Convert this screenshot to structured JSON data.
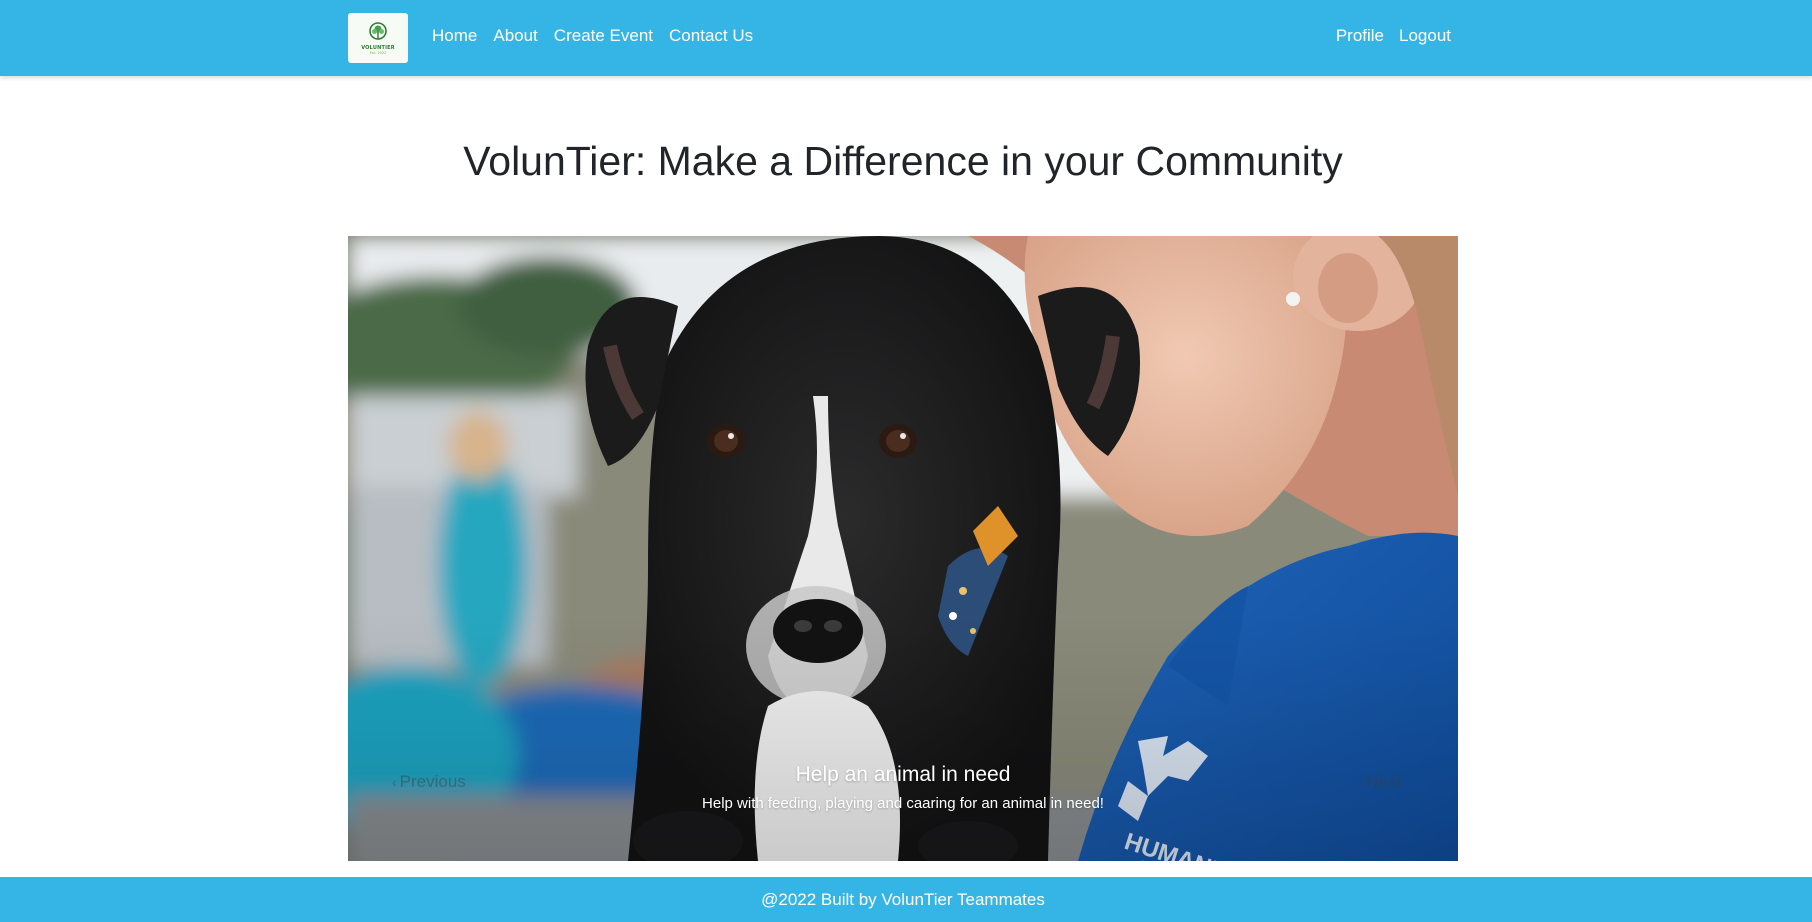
{
  "brand": {
    "logo_text": "VOLUNTIER",
    "logo_subtext": "Est. 2022"
  },
  "nav": {
    "left": [
      {
        "label": "Home"
      },
      {
        "label": "About"
      },
      {
        "label": "Create Event"
      },
      {
        "label": "Contact Us"
      }
    ],
    "right": [
      {
        "label": "Profile"
      },
      {
        "label": "Logout"
      }
    ]
  },
  "main": {
    "title": "VolunTier: Make a Difference in your Community"
  },
  "carousel": {
    "prev_label": "Previous",
    "next_label": "Next",
    "prev_icon": "chevron-left-icon",
    "next_icon": "chevron-right-icon",
    "slide": {
      "caption_title": "Help an animal in need",
      "caption_text": "Help with feeding, playing and caaring for an animal in need!",
      "image": "black puppy held by volunteer in blue shirt"
    }
  },
  "footer": {
    "text": "@2022 Built by VolunTier Teammates"
  },
  "colors": {
    "brand_blue": "#35b5e5",
    "title_text": "#212529",
    "white": "#ffffff"
  }
}
